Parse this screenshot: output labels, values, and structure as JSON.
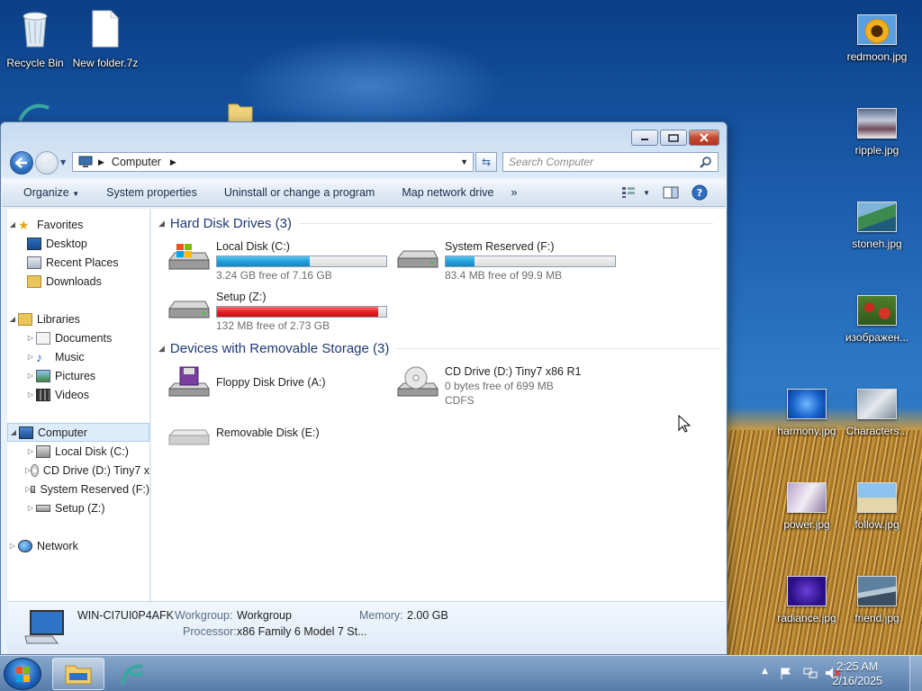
{
  "desktop": {
    "icons": [
      {
        "label": "Recycle Bin",
        "icon": "recycle-bin-icon"
      },
      {
        "label": "New folder.7z",
        "icon": "archive-file-icon"
      },
      {
        "label": "redmoon.jpg",
        "icon": "image-thumbnail"
      },
      {
        "label": "ripple.jpg",
        "icon": "image-thumbnail"
      },
      {
        "label": "stoneh.jpg",
        "icon": "image-thumbnail"
      },
      {
        "label": "изображен...",
        "icon": "image-thumbnail"
      },
      {
        "label": "harmony.jpg",
        "icon": "image-thumbnail"
      },
      {
        "label": "Characters...",
        "icon": "image-thumbnail"
      },
      {
        "label": "power.jpg",
        "icon": "image-thumbnail"
      },
      {
        "label": "follow.jpg",
        "icon": "image-thumbnail"
      },
      {
        "label": "radiance.jpg",
        "icon": "image-thumbnail"
      },
      {
        "label": "friend.jpg",
        "icon": "image-thumbnail"
      }
    ]
  },
  "window": {
    "address": {
      "crumb": "Computer"
    },
    "search_placeholder": "Search Computer",
    "toolbar": {
      "organize": "Organize",
      "system_properties": "System properties",
      "uninstall": "Uninstall or change a program",
      "map_drive": "Map network drive",
      "more": "»"
    },
    "nav": {
      "favorites": "Favorites",
      "desktop": "Desktop",
      "recent": "Recent Places",
      "downloads": "Downloads",
      "libraries": "Libraries",
      "documents": "Documents",
      "music": "Music",
      "pictures": "Pictures",
      "videos": "Videos",
      "computer": "Computer",
      "local_disk": "Local Disk (C:)",
      "cd_drive": "CD Drive (D:) Tiny7 x",
      "system_reserved": "System Reserved (F:)",
      "setup": "Setup (Z:)",
      "network": "Network"
    },
    "groups": {
      "hdd": "Hard Disk Drives (3)",
      "removable": "Devices with Removable Storage (3)"
    },
    "drives": {
      "c": {
        "name": "Local Disk (C:)",
        "free": "3.24 GB free of 7.16 GB",
        "used_fraction": 0.55
      },
      "f": {
        "name": "System Reserved (F:)",
        "free": "83.4 MB free of 99.9 MB",
        "used_fraction": 0.17
      },
      "z": {
        "name": "Setup (Z:)",
        "free": "132 MB free of 2.73 GB",
        "used_fraction": 0.95
      },
      "a": {
        "name": "Floppy Disk Drive (A:)"
      },
      "d": {
        "name": "CD Drive (D:) Tiny7 x86 R1",
        "free": "0 bytes free of 699 MB",
        "fs": "CDFS"
      },
      "e": {
        "name": "Removable Disk (E:)"
      }
    },
    "details": {
      "computer_name": "WIN-CI7UI0P4AFK",
      "workgroup_label": "Workgroup:",
      "workgroup": "Workgroup",
      "memory_label": "Memory:",
      "memory": "2.00 GB",
      "processor_label": "Processor:",
      "processor": "x86 Family 6 Model 7 St..."
    }
  },
  "taskbar": {
    "time": "2:25 AM",
    "date": "2/16/2025"
  }
}
